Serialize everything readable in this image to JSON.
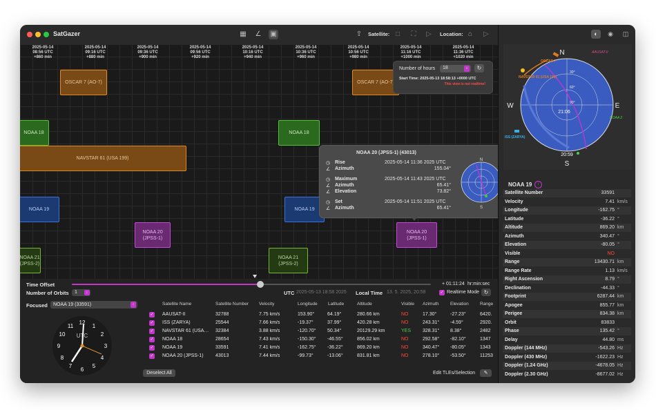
{
  "app": {
    "title": "SatGazer"
  },
  "toolbar": {
    "satellite_label": "Satellite:",
    "location_label": "Location:"
  },
  "timeline": {
    "ticks": [
      {
        "date": "2025-05-14",
        "time": "08:56 UTC",
        "offset": "+860 min"
      },
      {
        "date": "2025-05-14",
        "time": "09:16 UTC",
        "offset": "+880 min"
      },
      {
        "date": "2025-05-14",
        "time": "09:36 UTC",
        "offset": "+900 min"
      },
      {
        "date": "2025-05-14",
        "time": "09:56 UTC",
        "offset": "+920 min"
      },
      {
        "date": "2025-05-14",
        "time": "10:16 UTC",
        "offset": "+940 min"
      },
      {
        "date": "2025-05-14",
        "time": "10:36 UTC",
        "offset": "+960 min"
      },
      {
        "date": "2025-05-14",
        "time": "10:56 UTC",
        "offset": "+980 min"
      },
      {
        "date": "2025-05-14",
        "time": "11:16 UTC",
        "offset": "+1000 min"
      },
      {
        "date": "2025-05-14",
        "time": "11:36 UTC",
        "offset": "+1020 min"
      }
    ],
    "passes": {
      "oscar_a": "OSCAR 7 (AO-7)",
      "oscar_b": "OSCAR 7 (AO-7)",
      "noaa18_a": "NOAA 18",
      "noaa18_b": "NOAA 18",
      "navstar": "NAVSTAR 61 (USA 199)",
      "noaa19_a": "NOAA 19",
      "noaa19_b": "NOAA 19",
      "noaa20_a": "NOAA 20\n(JPSS-1)",
      "noaa20_b": "NOAA 20\n(JPSS-1)",
      "noaa21_a": "NOAA 21\n(JPSS-2)",
      "noaa21_b": "NOAA 21\n(JPSS-2)"
    }
  },
  "hours_popover": {
    "label": "Number of hours",
    "value": "18",
    "start_time": "Start Time: 2025-05-13 18:58:13 +0000 UTC",
    "warning": "This view is not realtime!"
  },
  "detail_popover": {
    "title": "NOAA 20 (JPSS-1) (43013)",
    "rise_label": "Rise",
    "rise_value": "2025-05-14 11:36 2025 UTC",
    "rise_az_label": "Azimuth",
    "rise_az_value": "155.04°",
    "max_label": "Maximum",
    "max_value": "2025-05-14 11:43 2025 UTC",
    "max_az_label": "Azimuth",
    "max_az_value": "65.41°",
    "max_el_label": "Elevation",
    "max_el_value": "73.82°",
    "set_label": "Set",
    "set_value": "2025-05-14 11:51 2025 UTC",
    "set_az_label": "Azimuth",
    "set_az_value": "65.41°",
    "compass": {
      "n": "N",
      "s": "S"
    }
  },
  "controls": {
    "time_offset_label": "Time Offset",
    "time_offset_value": "+ 01:11:24",
    "time_offset_format": "hr:min:sec",
    "orbits_label": "Number of Orbits",
    "orbits_value": "1",
    "utc_label": "UTC",
    "utc_value": "2025-05-13 18:58 2025",
    "local_label": "Local Time",
    "local_value": "13. 5. 2025, 20:58",
    "realtime_label": "Realtime Mode",
    "focused_label": "Focused",
    "focused_value": "NOAA 19 (33591)",
    "deselect_label": "Deselect All",
    "edit_label": "Edit TLEs/Selection"
  },
  "clock": {
    "label": "UTC",
    "numbers": [
      "12",
      "1",
      "2",
      "3",
      "4",
      "5",
      "6",
      "7",
      "8",
      "9",
      "10",
      "11"
    ]
  },
  "table": {
    "headers": [
      "Satellite Name",
      "Satellite Number",
      "Velocity",
      "Longitude",
      "Latitude",
      "Altitude",
      "Visible",
      "Azimuth",
      "Elevation",
      "Range"
    ],
    "rows": [
      [
        "AAUSAT-II",
        "32788",
        "7.75 km/s",
        "153.90°",
        "64.19°",
        "280.66 km",
        "NO",
        "17.30°",
        "-27.23°",
        "6420."
      ],
      [
        "ISS (ZARYA)",
        "25544",
        "7.66 km/s",
        "-19.37°",
        "37.99°",
        "420.28 km",
        "NO",
        "243.31°",
        "-4.59°",
        "2920."
      ],
      [
        "NAVSTAR 61 (USA…",
        "32384",
        "3.88 km/s",
        "-120.70°",
        "50.34°",
        "20129.29 km",
        "YES",
        "328.31°",
        "8.38°",
        "2482"
      ],
      [
        "NOAA 18",
        "28654",
        "7.43 km/s",
        "-150.30°",
        "-46.55°",
        "856.02 km",
        "NO",
        "292.58°",
        "-82.10°",
        "1347"
      ],
      [
        "NOAA 19",
        "33591",
        "7.41 km/s",
        "-162.75°",
        "-36.22°",
        "869.20 km",
        "NO",
        "340.47°",
        "-80.05°",
        "1343"
      ],
      [
        "NOAA 20 (JPSS-1)",
        "43013",
        "7.44 km/s",
        "-99.73°",
        "-13.06°",
        "831.81 km",
        "NO",
        "278.10°",
        "-53.50°",
        "11253"
      ]
    ]
  },
  "polar": {
    "n": "N",
    "s": "S",
    "e": "E",
    "w": "W",
    "rings": [
      "30°",
      "60°",
      "90°"
    ],
    "t1": "21:06",
    "t2": "20:59",
    "labels": {
      "aausat": "AAUSAT-II",
      "oscar": "OSCAR 7",
      "navstar": "NAVSTAR 61 (USA 199)",
      "iss": "ISS (ZARYA)",
      "noaa2": "NOAA 2"
    }
  },
  "sidebar": {
    "title": "NOAA 19",
    "props": [
      {
        "k": "Satellite Number",
        "v": "33591",
        "u": ""
      },
      {
        "k": "Velocity",
        "v": "7.41",
        "u": "km/s"
      },
      {
        "k": "Longitude",
        "v": "-162.75",
        "u": "°"
      },
      {
        "k": "Latitude",
        "v": "-36.22",
        "u": "°"
      },
      {
        "k": "Altitude",
        "v": "869.20",
        "u": "km"
      },
      {
        "k": "Azimuth",
        "v": "340.47",
        "u": "°"
      },
      {
        "k": "Elevation",
        "v": "-80.05",
        "u": "°"
      },
      {
        "k": "Visible",
        "v": "NO",
        "u": ""
      },
      {
        "k": "Range",
        "v": "13430.71",
        "u": "km"
      },
      {
        "k": "Range Rate",
        "v": "1.13",
        "u": "km/s"
      },
      {
        "k": "Right Ascension",
        "v": "8.79",
        "u": "°"
      },
      {
        "k": "Declination",
        "v": "-44.33",
        "u": "°"
      },
      {
        "k": "Footprint",
        "v": "6287.44",
        "u": "km"
      },
      {
        "k": "Apogee",
        "v": "855.77",
        "u": "km"
      },
      {
        "k": "Perigee",
        "v": "834.38",
        "u": "km"
      },
      {
        "k": "Orbit",
        "v": "83833",
        "u": ""
      },
      {
        "k": "Phase",
        "v": "135.42",
        "u": "°"
      },
      {
        "k": "Delay",
        "v": "44.80",
        "u": "ms"
      },
      {
        "k": "Doppler (144 MHz)",
        "v": "-543.26",
        "u": "Hz"
      },
      {
        "k": "Doppler (430 MHz)",
        "v": "-1622.23",
        "u": "Hz"
      },
      {
        "k": "Doppler (1.24 GHz)",
        "v": "-4678.05",
        "u": "Hz"
      },
      {
        "k": "Doppler (2.30 GHz)",
        "v": "-8677.02",
        "u": "Hz"
      }
    ]
  }
}
